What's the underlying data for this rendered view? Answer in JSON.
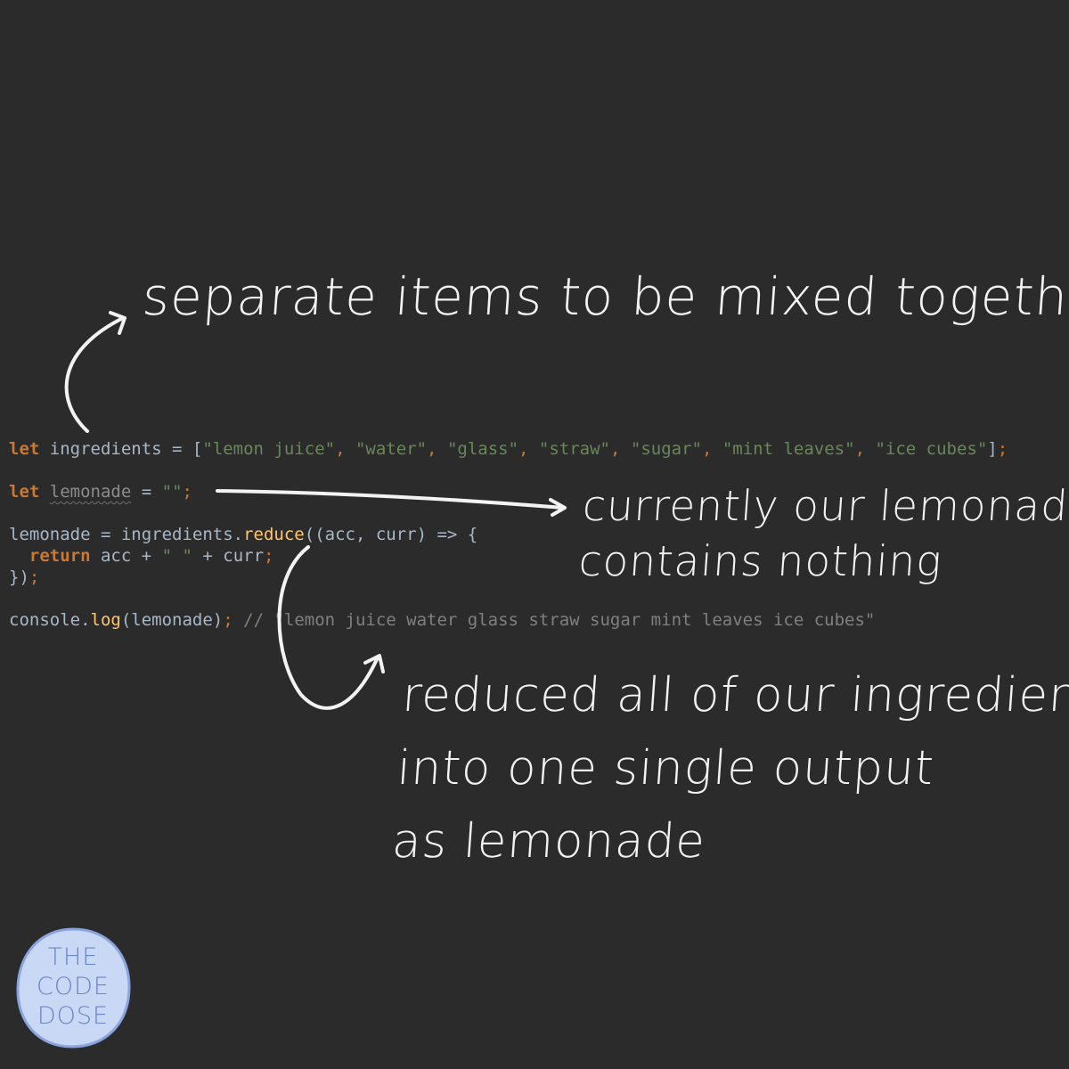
{
  "code": {
    "line1": {
      "kw": "let",
      "name": " ingredients = [",
      "items": [
        "\"lemon juice\"",
        "\"water\"",
        "\"glass\"",
        "\"straw\"",
        "\"sugar\"",
        "\"mint leaves\"",
        "\"ice cubes\""
      ],
      "sep": ", ",
      "close": "]",
      "semi": ";"
    },
    "line2": {
      "kw": "let",
      "var": "lemonade",
      "assign": " = ",
      "str": "\"\"",
      "semi": ";"
    },
    "line3": {
      "pre": "lemonade = ingredients.",
      "fn": "reduce",
      "post": "((acc, curr) => {"
    },
    "line4": {
      "indent": "  ",
      "kw": "return",
      "pre": " acc + ",
      "str": "\" \"",
      "post": " + curr",
      "semi": ";"
    },
    "line5": {
      "text": "})",
      "semi": ";"
    },
    "line6": {
      "pre": "console.",
      "fn": "log",
      "post": "(lemonade)",
      "semi": ";",
      "comment": " // \"lemon juice water glass straw sugar mint leaves ice cubes\""
    }
  },
  "annotations": {
    "items_note": "separate items to be mixed together",
    "empty_note": [
      "currently our lemonade",
      "contains nothing"
    ],
    "reduce_note": [
      "reduced all of our ingredients",
      "into one single output",
      "as lemonade"
    ]
  },
  "logo": {
    "lines": [
      "THE",
      "CODE",
      "DOSE"
    ],
    "fill_color": "#c9d8f5",
    "ring_color": "#8aa4e0",
    "text_color": "#6a86c7"
  },
  "colors": {
    "background": "#2b2b2b",
    "keyword": "#cc7832",
    "string": "#6a8759",
    "function": "#ffc66d",
    "identifier": "#a9b7c6",
    "comment": "#808080",
    "handwriting": "#f3f3f3"
  }
}
